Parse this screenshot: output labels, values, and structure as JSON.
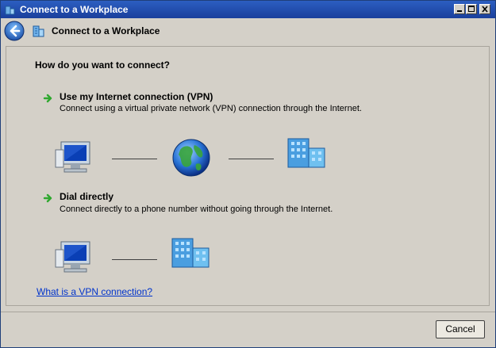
{
  "window": {
    "title": "Connect to a Workplace",
    "controls": {
      "minimize": "minimize",
      "maximize": "maximize",
      "close": "close"
    }
  },
  "header": {
    "title": "Connect to a Workplace",
    "back_icon": "back-arrow-icon",
    "app_icon": "workplace-icon"
  },
  "main": {
    "question": "How do you want to connect?",
    "options": [
      {
        "title": "Use my Internet connection (VPN)",
        "description": "Connect using a virtual private network (VPN) connection through the Internet.",
        "icon": "green-arrow-icon"
      },
      {
        "title": "Dial directly",
        "description": "Connect directly to a phone number without going through the Internet.",
        "icon": "green-arrow-icon"
      }
    ],
    "help_link": "What is a VPN connection?"
  },
  "footer": {
    "cancel_label": "Cancel"
  },
  "colors": {
    "titlebar": "#1a3f9c",
    "dialog_bg": "#d4d0c8",
    "link": "#0033cc",
    "arrow": "#2fa82f"
  }
}
